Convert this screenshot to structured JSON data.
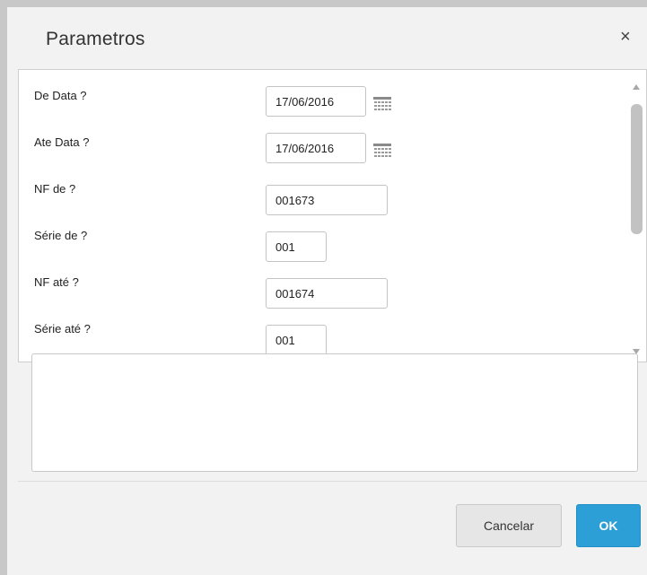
{
  "dialog": {
    "title": "Parametros",
    "close_symbol": "×"
  },
  "params": [
    {
      "label": "De Data ?",
      "value": "17/06/2016",
      "calendar": true
    },
    {
      "label": "Ate Data ?",
      "value": "17/06/2016",
      "calendar": true
    },
    {
      "label": "NF de ?",
      "value": "001673",
      "calendar": false
    },
    {
      "label": "Série de ?",
      "value": "001",
      "calendar": false
    },
    {
      "label": "NF até ?",
      "value": "001674",
      "calendar": false
    },
    {
      "label": "Série até ?",
      "value": "001",
      "calendar": false
    }
  ],
  "message": "",
  "buttons": {
    "cancel": "Cancelar",
    "ok": "OK"
  },
  "colors": {
    "ok_button": "#2b9fd6",
    "cancel_button": "#e6e6e6",
    "background": "#f2f2f2"
  },
  "icons": {
    "close": "close-icon",
    "calendar": "calendar-icon",
    "scroll_up": "scroll-up-arrow-icon",
    "scroll_down": "scroll-down-arrow-icon"
  }
}
